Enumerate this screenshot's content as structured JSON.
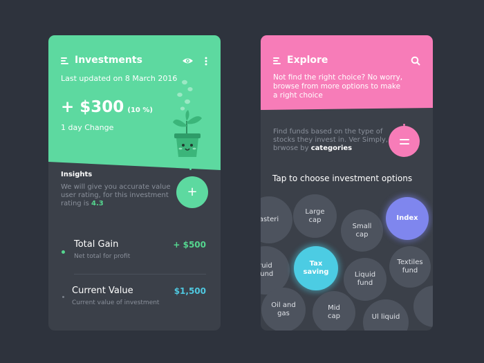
{
  "investments": {
    "title": "Investments",
    "last_updated": "Last updated on 8 March 2016",
    "change_value": "+ $300",
    "change_percent": "(10 %)",
    "change_label": "1 day Change",
    "insights_title": "Insights",
    "insights_line1": "We will give you accurate value",
    "insights_line2": "user rating, for this investment",
    "insights_line3": "rating is",
    "rating": "4.3",
    "add_label": "+",
    "total_gain_label": "Total Gain",
    "total_gain_value": "+ $500",
    "total_gain_desc": "Net total for profit",
    "current_value_label": "Current Value",
    "current_value_value": "$1,500",
    "current_value_desc": "Current value of investment"
  },
  "explore": {
    "title": "Explore",
    "promo_line1": "Not find the right choice? No worry,",
    "promo_line2": "browse from more options to make",
    "promo_line3": "a right choice",
    "funds_line1": "Find funds based on the type of",
    "funds_line2": "stocks they invest in. Ver Simply,",
    "funds_line3": "brwose by",
    "funds_link": "categories",
    "options_heading": "Tap to choose investment options",
    "bubbles": {
      "easterni": "asteri",
      "large_cap": "Large\ncap",
      "small_cap": "Small\ncap",
      "index": "Index",
      "fluid_fund": "ruid\nfund",
      "tax_saving": "Tax\nsaving",
      "liquid_fund": "Liquid\nfund",
      "textiles_fund": "Textiles\nfund",
      "oil_gas": "Oil and\ngas",
      "mid_cap": "Mid\ncap",
      "ul_liquid": "Ul liquid"
    }
  },
  "colors": {
    "background": "#2e333d",
    "card_dark": "#3b4049",
    "investments_accent": "#5dd9a0",
    "explore_accent": "#f77cb8",
    "gain_green": "#55d68f",
    "value_cyan": "#4fc8e0",
    "index_bubble": "#7f86ee",
    "tax_bubble": "#4ccce3",
    "bubble_gray": "#4d535e"
  },
  "icons": {
    "menu": "hamburger-icon",
    "visibility": "eye-icon",
    "more": "more-vertical-icon",
    "search": "search-icon",
    "filter": "filter-icon",
    "add": "plus-icon",
    "plant": "plant-pot-illustration",
    "coins": "coin-icon"
  }
}
